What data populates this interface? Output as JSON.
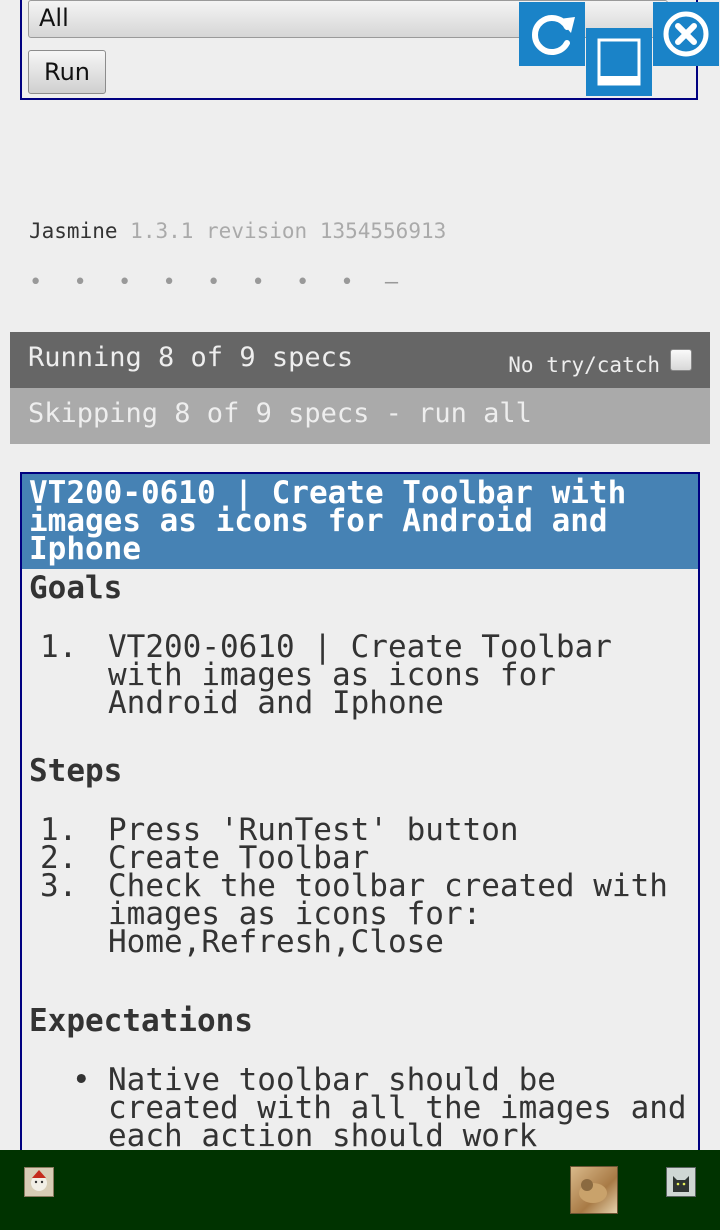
{
  "filter": {
    "selected": "All"
  },
  "run_label": "Run",
  "toolbar": {
    "refresh_icon": "refresh-icon",
    "home_icon": "home-icon",
    "close_icon": "close-icon",
    "color": "#1a83c8"
  },
  "reporter": {
    "name": "Jasmine",
    "version": "1.3.1 revision 1354556913",
    "dots": "• • • • • • • • –",
    "running": "Running 8 of 9 specs",
    "no_try_catch": "No try/catch",
    "skipping": "Skipping 8 of 9 specs - run all"
  },
  "spec": {
    "title": "VT200-0610 | Create Toolbar with images as icons for Android and Iphone",
    "goals_heading": "Goals",
    "goals": [
      {
        "num": "1.",
        "text": "VT200-0610 | Create Toolbar with images as icons for Android and Iphone"
      }
    ],
    "steps_heading": "Steps",
    "steps": [
      {
        "num": "1.",
        "text": "Press 'RunTest' button"
      },
      {
        "num": "2.",
        "text": "Create Toolbar"
      },
      {
        "num": "3.",
        "text": "Check the toolbar created with images as icons for: Home,Refresh,Close"
      }
    ],
    "expectations_heading": "Expectations",
    "expectations": [
      {
        "bullet": "•",
        "text": "Native toolbar should be created with all the images and each action should work"
      }
    ]
  },
  "bottom_bar": {
    "color": "#003300"
  }
}
